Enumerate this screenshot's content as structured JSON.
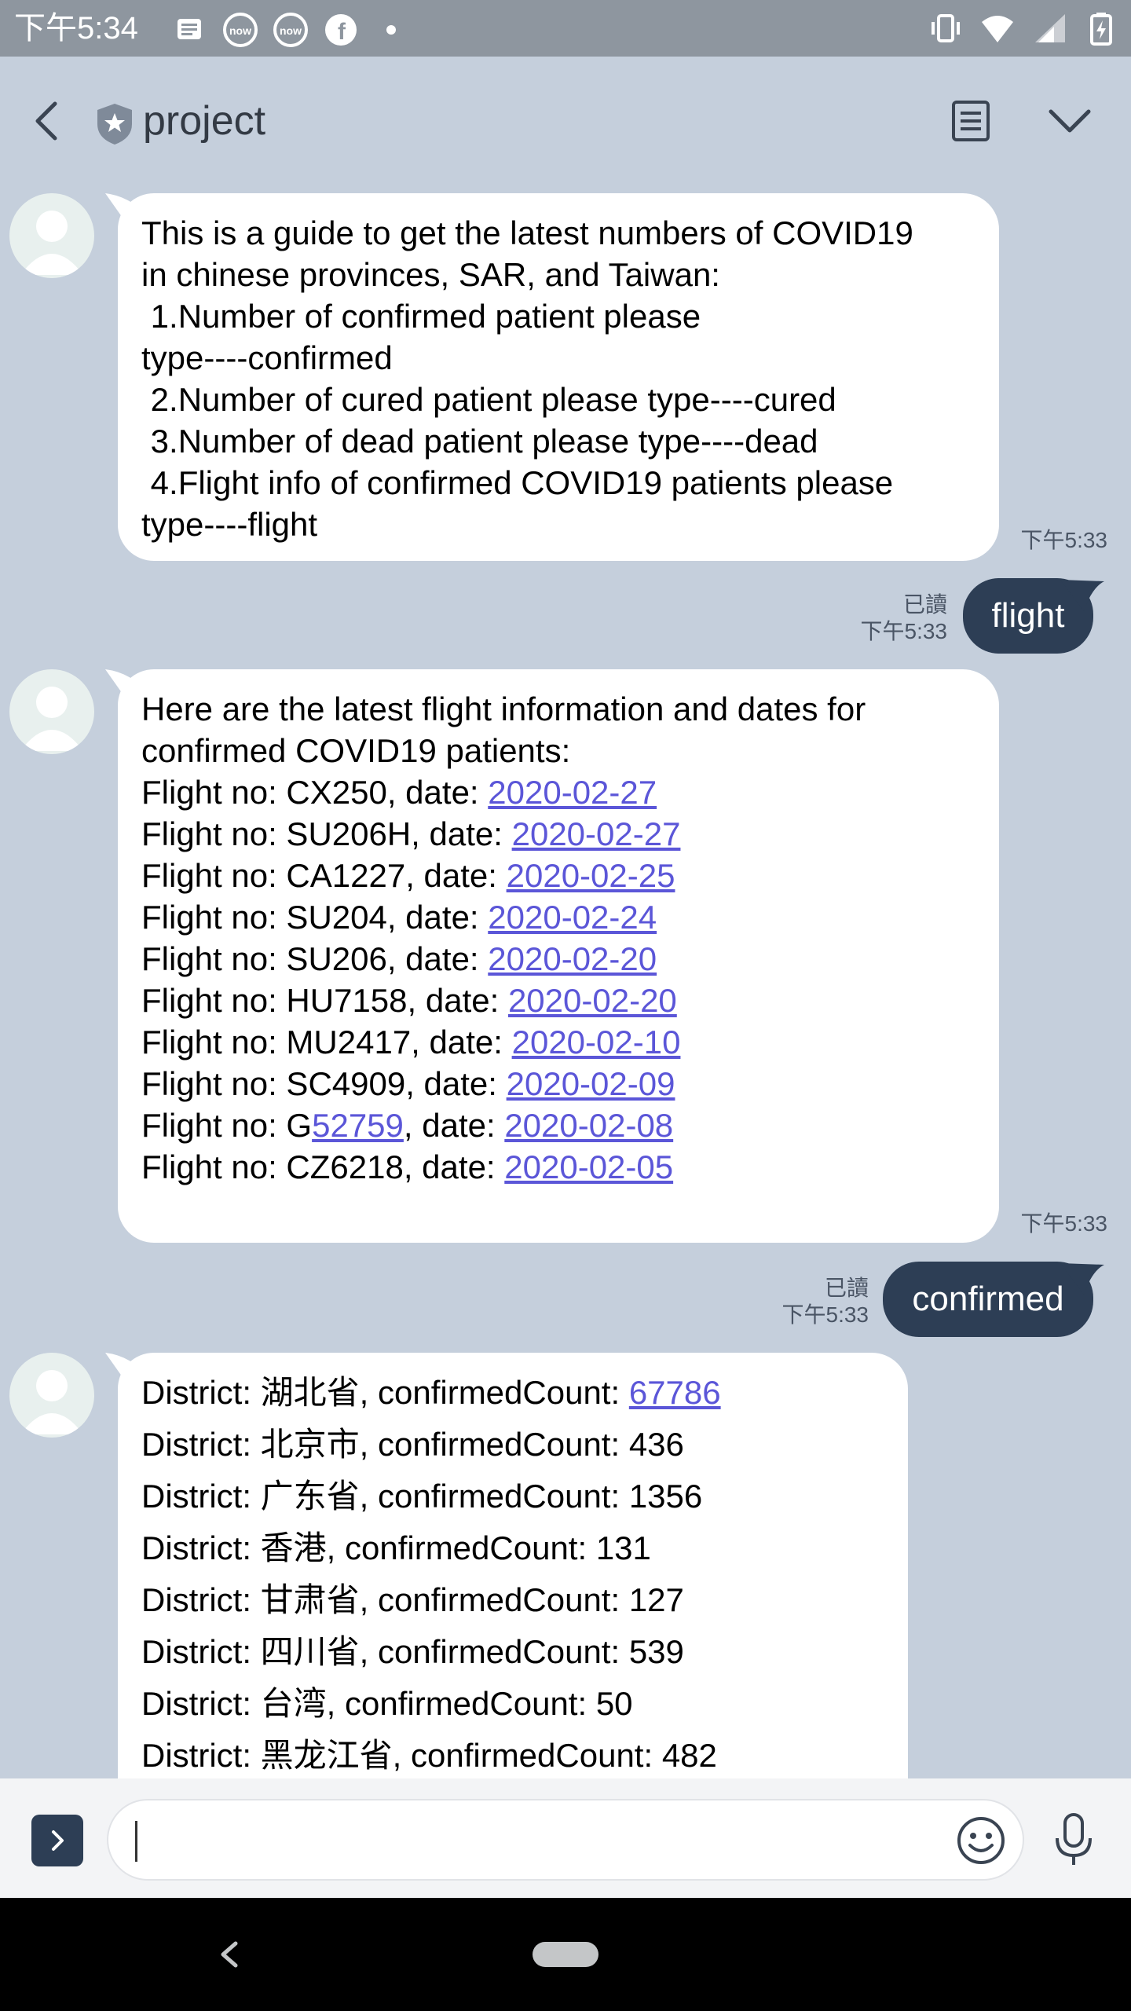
{
  "status_bar": {
    "time": "下午5:34",
    "left_icons": [
      "message-icon",
      "now-app-icon",
      "now-app-icon",
      "facebook-icon",
      "dot-icon"
    ],
    "right_icons": [
      "vibrate-icon",
      "wifi-icon",
      "signal-icon",
      "battery-icon"
    ]
  },
  "header": {
    "title": "project",
    "icons": [
      "back-arrow-icon",
      "shield-icon",
      "notes-icon",
      "chevron-down-icon"
    ]
  },
  "messages": {
    "m1": {
      "lines": [
        "This is a guide to get the latest numbers of COVID19",
        "in chinese provinces, SAR, and Taiwan:",
        " 1.Number of confirmed patient please",
        "type----confirmed",
        " 2.Number of cured patient please type----cured",
        " 3.Number of dead patient please type----dead",
        " 4.Flight info of confirmed COVID19 patients please",
        "type----flight"
      ],
      "time": "下午5:33"
    },
    "u1": {
      "text": "flight",
      "read": "已讀",
      "time": "下午5:33"
    },
    "m2": {
      "intro": [
        "Here are the latest flight information and dates for",
        "confirmed COVID19 patients:"
      ],
      "flights": [
        {
          "prefix": "Flight no: CX250, date: ",
          "date": "2020-02-27"
        },
        {
          "prefix": "Flight no: SU206H, date: ",
          "date": "2020-02-27"
        },
        {
          "prefix": "Flight no: CA1227, date: ",
          "date": "2020-02-25"
        },
        {
          "prefix": "Flight no: SU204, date: ",
          "date": "2020-02-24"
        },
        {
          "prefix": "Flight no: SU206, date: ",
          "date": "2020-02-20"
        },
        {
          "prefix": "Flight no: HU7158, date: ",
          "date": "2020-02-20"
        },
        {
          "prefix": "Flight no: MU2417, date: ",
          "date": "2020-02-10"
        },
        {
          "prefix": "Flight no: SC4909, date: ",
          "date": "2020-02-09"
        }
      ],
      "special": {
        "a": "Flight no: G",
        "b": "52759",
        "c": ", date: ",
        "d": "2020-02-08"
      },
      "last": {
        "prefix": "Flight no: CZ6218, date: ",
        "date": "2020-02-05"
      },
      "time": "下午5:33"
    },
    "u2": {
      "text": "confirmed",
      "read": "已讀",
      "time": "下午5:33"
    },
    "m3": {
      "first": {
        "prefix": "District: 湖北省, confirmedCount: ",
        "count": "67786"
      },
      "rows": [
        "District: 北京市, confirmedCount: 436",
        "District: 广东省, confirmedCount: 1356",
        "District: 香港, confirmedCount: 131",
        "District: 甘肃省, confirmedCount: 127",
        "District: 四川省, confirmedCount: 539",
        "District: 台湾, confirmedCount: 50",
        "District: 黑龙江省, confirmedCount: 482"
      ]
    }
  },
  "input": {
    "icons": [
      "expand-icon",
      "emoji-icon",
      "microphone-icon"
    ]
  },
  "navbar": {
    "icons": [
      "nav-back-icon",
      "home-pill-icon"
    ]
  },
  "colors": {
    "background": "#c5cfdc",
    "status_bar": "#8e969f",
    "out_bubble": "#2d3e55",
    "in_bubble": "#ffffff",
    "link": "#5b56d8"
  }
}
